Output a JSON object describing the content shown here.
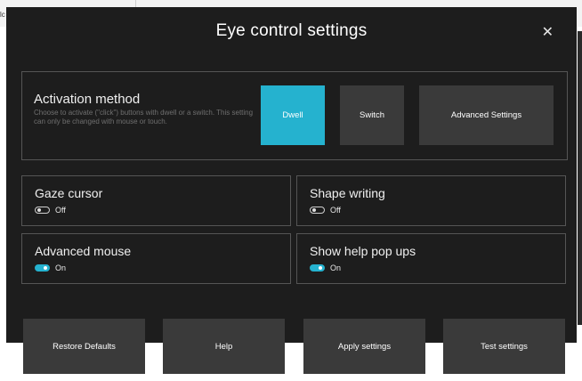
{
  "background": {
    "left_fragment_text": "lc"
  },
  "dialog": {
    "title": "Eye control settings",
    "close_glyph": "✕"
  },
  "activation": {
    "title": "Activation method",
    "description": "Choose to activate (\"click\") buttons with dwell or a switch. This setting can only be changed with mouse or touch.",
    "buttons": {
      "dwell": "Dwell",
      "switch": "Switch",
      "advanced": "Advanced Settings"
    },
    "selected": "Dwell",
    "accent_color": "#25b2cf"
  },
  "toggles": [
    {
      "title": "Gaze cursor",
      "state": "Off",
      "on": false
    },
    {
      "title": "Shape writing",
      "state": "Off",
      "on": false
    },
    {
      "title": "Advanced mouse",
      "state": "On",
      "on": true
    },
    {
      "title": "Show help pop ups",
      "state": "On",
      "on": true
    }
  ],
  "footer": {
    "restore": "Restore Defaults",
    "help": "Help",
    "apply": "Apply settings",
    "test": "Test settings"
  }
}
